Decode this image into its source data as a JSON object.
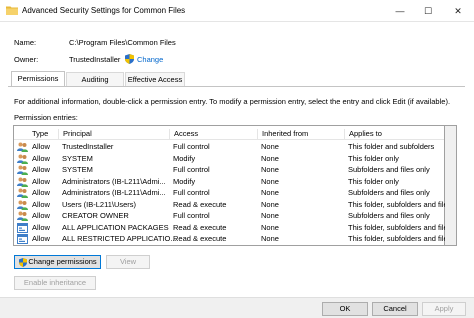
{
  "window": {
    "title": "Advanced Security Settings for Common Files",
    "minimize_glyph": "—",
    "maximize_glyph": "☐",
    "close_glyph": "✕"
  },
  "header": {
    "name_label": "Name:",
    "name_value": "C:\\Program Files\\Common Files",
    "owner_label": "Owner:",
    "owner_value": "TrustedInstaller",
    "change_link": "Change"
  },
  "tabs": [
    {
      "label": "Permissions",
      "active": true
    },
    {
      "label": "Auditing",
      "active": false
    },
    {
      "label": "Effective Access",
      "active": false
    }
  ],
  "info_text": "For additional information, double-click a permission entry. To modify a permission entry, select the entry and click Edit (if available).",
  "entries_label": "Permission entries:",
  "table": {
    "columns": [
      "Type",
      "Principal",
      "Access",
      "Inherited from",
      "Applies to"
    ],
    "rows": [
      {
        "icon": "users-icon",
        "type": "Allow",
        "principal": "TrustedInstaller",
        "access": "Full control",
        "inherited": "None",
        "applies": "This folder and subfolders"
      },
      {
        "icon": "users-icon",
        "type": "Allow",
        "principal": "SYSTEM",
        "access": "Modify",
        "inherited": "None",
        "applies": "This folder only"
      },
      {
        "icon": "users-icon",
        "type": "Allow",
        "principal": "SYSTEM",
        "access": "Full control",
        "inherited": "None",
        "applies": "Subfolders and files only"
      },
      {
        "icon": "users-icon",
        "type": "Allow",
        "principal": "Administrators (IB-L211\\Admi...",
        "access": "Modify",
        "inherited": "None",
        "applies": "This folder only"
      },
      {
        "icon": "users-icon",
        "type": "Allow",
        "principal": "Administrators (IB-L211\\Admi...",
        "access": "Full control",
        "inherited": "None",
        "applies": "Subfolders and files only"
      },
      {
        "icon": "users-icon",
        "type": "Allow",
        "principal": "Users (IB-L211\\Users)",
        "access": "Read & execute",
        "inherited": "None",
        "applies": "This folder, subfolders and files"
      },
      {
        "icon": "users-icon",
        "type": "Allow",
        "principal": "CREATOR OWNER",
        "access": "Full control",
        "inherited": "None",
        "applies": "Subfolders and files only"
      },
      {
        "icon": "package-icon",
        "type": "Allow",
        "principal": "ALL APPLICATION PACKAGES",
        "access": "Read & execute",
        "inherited": "None",
        "applies": "This folder, subfolders and files"
      },
      {
        "icon": "package-icon",
        "type": "Allow",
        "principal": "ALL RESTRICTED APPLICATIO...",
        "access": "Read & execute",
        "inherited": "None",
        "applies": "This folder, subfolders and files"
      }
    ]
  },
  "buttons": {
    "change_permissions": "Change permissions",
    "view": "View",
    "enable_inheritance": "Enable inheritance",
    "ok": "OK",
    "cancel": "Cancel",
    "apply": "Apply"
  },
  "colors": {
    "link": "#0066cc",
    "focus": "#0078d7",
    "shield_blue": "#2a6fc9",
    "shield_yellow": "#f2c200"
  }
}
